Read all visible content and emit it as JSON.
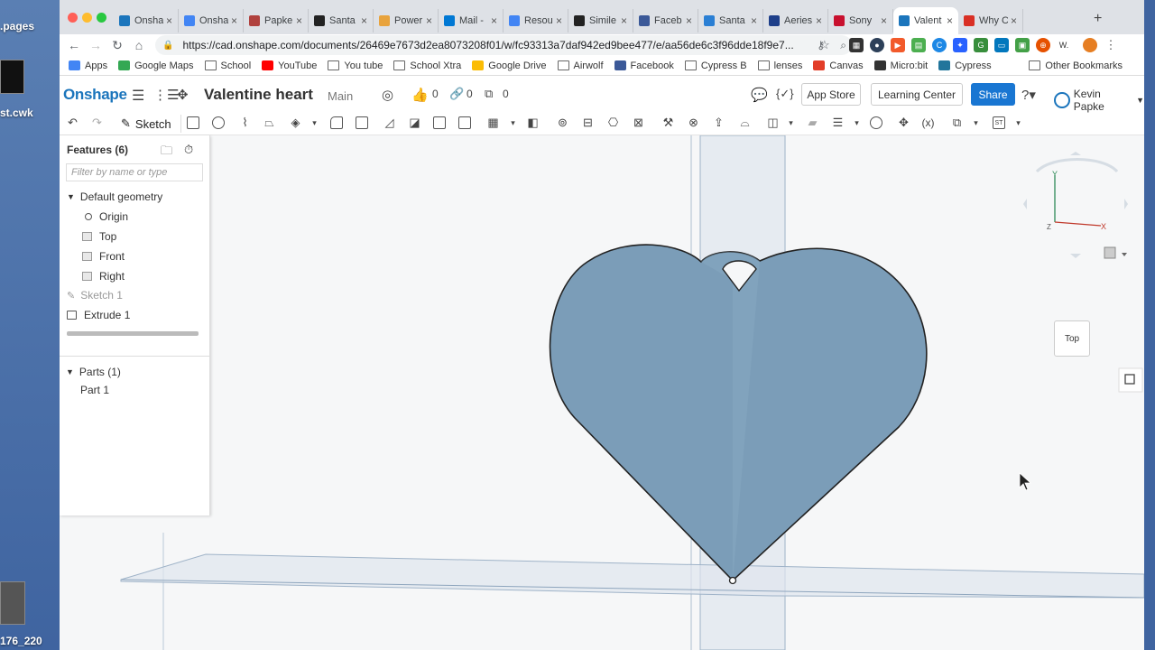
{
  "desktop": {
    "labels": [
      ".pages",
      "st.cwk",
      "176_220"
    ]
  },
  "window_controls": {
    "close": "#ff5f57",
    "minimize": "#febc2e",
    "maximize": "#28c840"
  },
  "tabs": [
    {
      "title": "Onsha",
      "icon": "onshape-icon",
      "color": "#1b75bc"
    },
    {
      "title": "Onsha",
      "icon": "docs-icon",
      "color": "#4285f4"
    },
    {
      "title": "Papke",
      "icon": "record-icon",
      "color": "#b0413e"
    },
    {
      "title": "Santa",
      "icon": "blackboard-icon",
      "color": "#222"
    },
    {
      "title": "Power",
      "icon": "powerschool-icon",
      "color": "#e8a33d"
    },
    {
      "title": "Mail -",
      "icon": "outlook-icon",
      "color": "#0078d4"
    },
    {
      "title": "Resou",
      "icon": "docs-icon",
      "color": "#4285f4"
    },
    {
      "title": "Simile",
      "icon": "github-icon",
      "color": "#222"
    },
    {
      "title": "Faceb",
      "icon": "facebook-icon",
      "color": "#3b5998"
    },
    {
      "title": "Santa",
      "icon": "globe-icon",
      "color": "#2a7fd4"
    },
    {
      "title": "Aeries",
      "icon": "aeries-icon",
      "color": "#1e3f8a"
    },
    {
      "title": "Sony",
      "icon": "sony-icon",
      "color": "#c8102e"
    },
    {
      "title": "Valent",
      "icon": "onshape-icon",
      "color": "#1b75bc",
      "active": true
    },
    {
      "title": "Why C",
      "icon": "gmail-icon",
      "color": "#d93025"
    }
  ],
  "address_bar": {
    "url": "https://cad.onshape.com/documents/26469e7673d2ea8073208f01/w/fc93313a7daf942ed9bee477/e/aa56de6c3f96dde18f9e7..."
  },
  "bookmarks": [
    {
      "label": "Apps",
      "icon": "apps-grid-icon"
    },
    {
      "label": "Google Maps",
      "icon": "maps-icon"
    },
    {
      "label": "School",
      "icon": "folder-icon"
    },
    {
      "label": "YouTube",
      "icon": "youtube-icon"
    },
    {
      "label": "You tube",
      "icon": "folder-icon"
    },
    {
      "label": "School Xtra",
      "icon": "folder-icon"
    },
    {
      "label": "Google Drive",
      "icon": "drive-icon"
    },
    {
      "label": "Airwolf",
      "icon": "folder-icon"
    },
    {
      "label": "Facebook",
      "icon": "facebook-icon"
    },
    {
      "label": "Cypress B",
      "icon": "folder-icon"
    },
    {
      "label": "lenses",
      "icon": "folder-icon"
    },
    {
      "label": "Canvas",
      "icon": "canvas-icon"
    },
    {
      "label": "Micro:bit",
      "icon": "microbit-icon"
    },
    {
      "label": "Cypress",
      "icon": "wordpress-icon"
    }
  ],
  "other_bookmarks": "Other Bookmarks",
  "onshape": {
    "logo": "Onshape",
    "doc_title": "Valentine heart",
    "branch": "Main",
    "likes": "0",
    "links": "0",
    "copies": "0",
    "app_store": "App Store",
    "learning_center": "Learning Center",
    "share": "Share",
    "user": "Kevin Papke",
    "sketch_label": "Sketch",
    "brand_color": "#1b75bc"
  },
  "features": {
    "header": "Features (6)",
    "filter_placeholder": "Filter by name or type",
    "default_geometry": "Default geometry",
    "items": [
      "Origin",
      "Top",
      "Front",
      "Right",
      "Sketch 1",
      "Extrude 1"
    ],
    "parts_header": "Parts (1)",
    "parts": [
      "Part 1"
    ]
  },
  "view_cube": {
    "face": "Top",
    "y_axis": "Y",
    "x_axis": "X",
    "z_axis": "Z"
  }
}
